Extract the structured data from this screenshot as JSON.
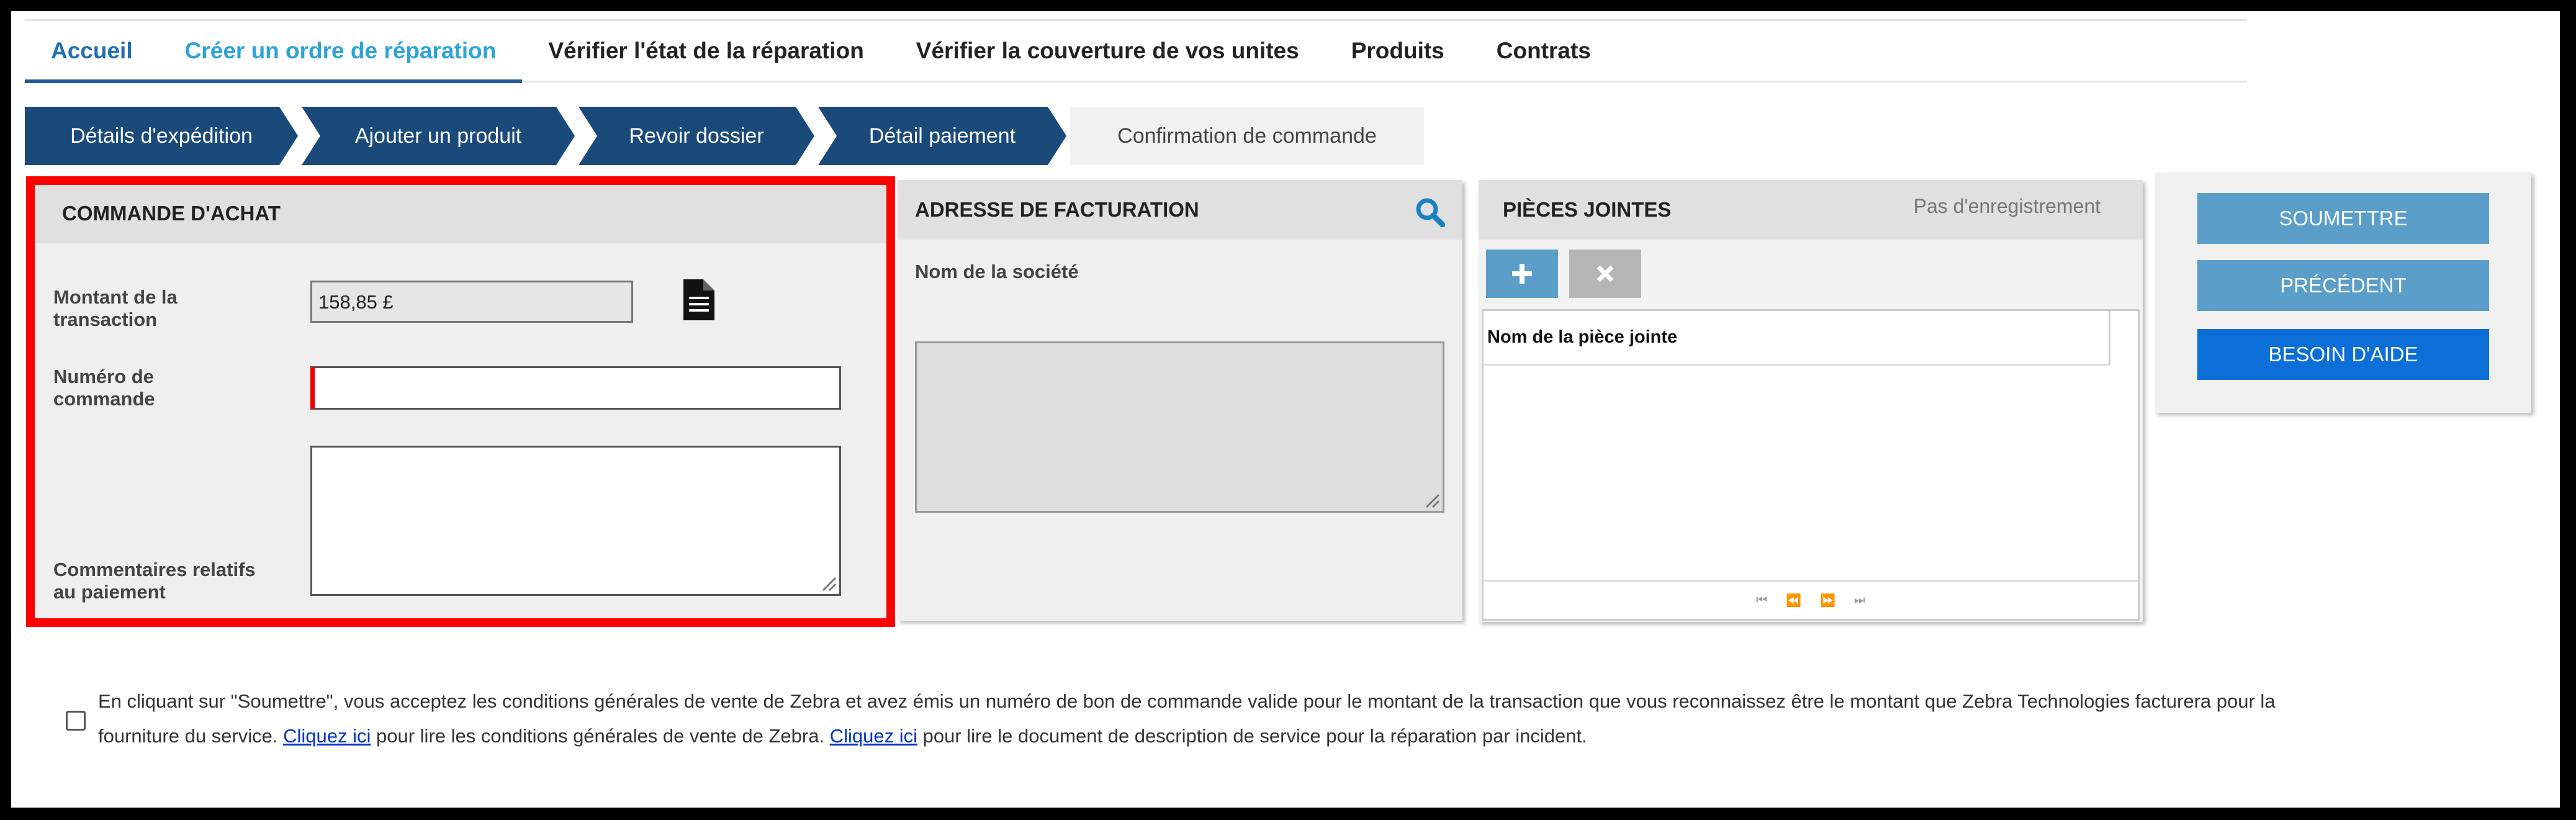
{
  "nav": {
    "tabs": [
      "Accueil",
      "Créer un ordre de réparation",
      "Vérifier l'état de la réparation",
      "Vérifier la couverture de vos unites",
      "Produits",
      "Contrats"
    ]
  },
  "steps": [
    "Détails d'expédition",
    "Ajouter un produit",
    "Revoir dossier",
    "Détail paiement",
    "Confirmation de commande"
  ],
  "purchase_order": {
    "title": "COMMANDE D'ACHAT",
    "amount_label": "Montant de la transaction",
    "amount_value": "158,85 £",
    "po_label": "Numéro de commande",
    "po_value": "",
    "comments_label": "Commentaires relatifs au paiement"
  },
  "billing": {
    "title": "ADRESSE DE FACTURATION",
    "company_label": "Nom de la société"
  },
  "attachments": {
    "title": "PIÈCES JOINTES",
    "status": "Pas d'enregistrement",
    "column_name": "Nom de la pièce jointe"
  },
  "actions": {
    "submit": "SOUMETTRE",
    "previous": "PRÉCÉDENT",
    "help": "BESOIN D'AIDE"
  },
  "terms": {
    "text_1": "En cliquant sur \"Soumettre\", vous acceptez les conditions générales de vente de Zebra et avez émis un numéro de bon de commande valide pour le montant de la transaction que vous reconnaissez être le montant que Zebra Technologies facturera pour la fourniture du service.",
    "link_1": "Cliquez ici",
    "text_2": "pour lire les conditions générales de vente de Zebra.",
    "link_2": "Cliquez ici",
    "text_3": "pour lire le document de description de service pour la réparation par incident."
  },
  "colors": {
    "accent": "#2ba5d8",
    "step_bg": "#1a4a7a",
    "button_blue": "#5a9ec9",
    "help_blue": "#0c6fd8",
    "highlight_red": "#ff0000"
  }
}
